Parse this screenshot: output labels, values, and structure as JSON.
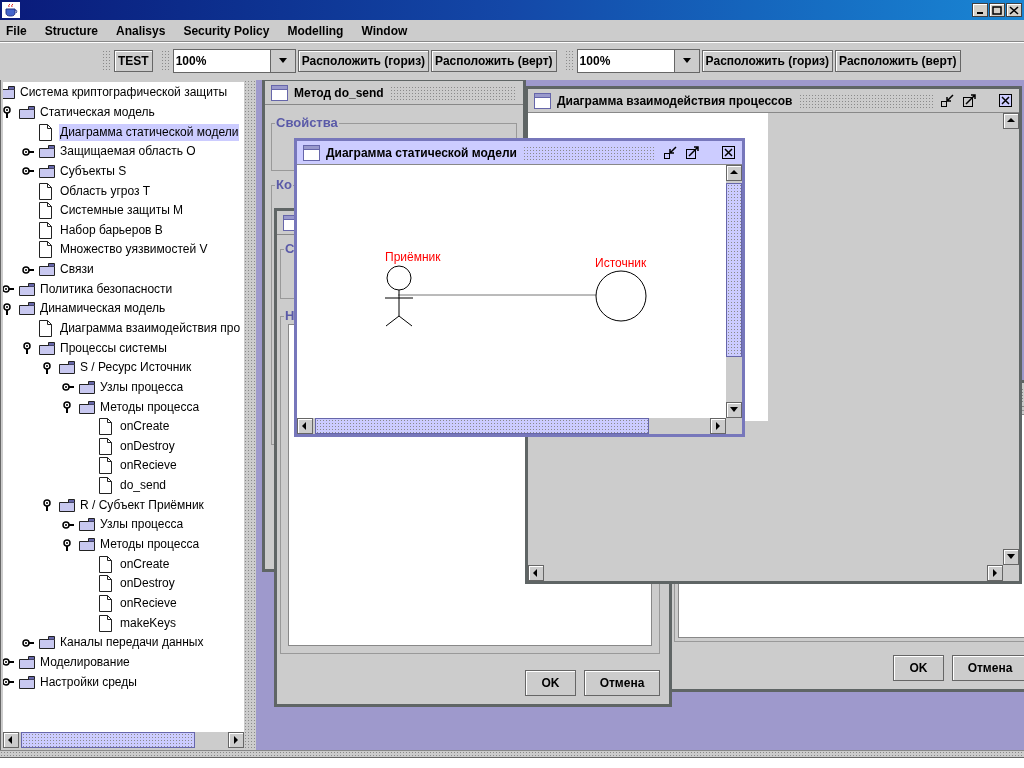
{
  "menu": [
    {
      "label": "File"
    },
    {
      "label": "Structure"
    },
    {
      "label": "Analisys"
    },
    {
      "label": "Security Policy"
    },
    {
      "label": "Modelling"
    },
    {
      "label": "Window"
    }
  ],
  "toolbar": [
    {
      "items": [
        {
          "kind": "button",
          "label": "TEST"
        }
      ]
    },
    {
      "items": [
        {
          "kind": "combo",
          "value": "100%"
        },
        {
          "kind": "button",
          "label": "Расположить (гориз)"
        },
        {
          "kind": "button",
          "label": "Расположить (верт)"
        }
      ]
    },
    {
      "items": [
        {
          "kind": "combo",
          "value": "100%"
        },
        {
          "kind": "button",
          "label": "Расположить (гориз)"
        },
        {
          "kind": "button",
          "label": "Расположить (верт)"
        }
      ]
    }
  ],
  "tree": {
    "label": "Система криптографической защиты",
    "kind": "folder",
    "selected": false,
    "children": [
      {
        "label": "Статическая модель",
        "kind": "folder",
        "expanded": true,
        "selected": false,
        "children": [
          {
            "label": "Диаграмма статической модели",
            "kind": "document",
            "selected": true
          },
          {
            "label": "Защищаемая область O",
            "kind": "folder",
            "expanded": false,
            "selected": false
          },
          {
            "label": "Субъекты S",
            "kind": "folder",
            "expanded": false,
            "selected": false
          },
          {
            "label": "Область угроз T",
            "kind": "document",
            "selected": false
          },
          {
            "label": "Системные защиты M",
            "kind": "document",
            "selected": false
          },
          {
            "label": "Набор барьеров B",
            "kind": "document",
            "selected": false
          },
          {
            "label": "Множество уязвимостей V",
            "kind": "document",
            "selected": false
          },
          {
            "label": "Связи",
            "kind": "folder",
            "expanded": false,
            "selected": false
          }
        ]
      },
      {
        "label": "Политика безопасности",
        "kind": "folder",
        "expanded": false,
        "selected": false
      },
      {
        "label": "Динамическая модель",
        "kind": "folder",
        "expanded": true,
        "selected": false,
        "children": [
          {
            "label": "Диаграмма взаимодействия про",
            "kind": "document",
            "selected": false
          },
          {
            "label": "Процессы системы",
            "kind": "folder",
            "expanded": true,
            "selected": false,
            "children": [
              {
                "label": "S / Ресурс Источник",
                "kind": "folder",
                "expanded": true,
                "selected": false,
                "children": [
                  {
                    "label": "Узлы процесса",
                    "kind": "folder",
                    "expanded": false,
                    "selected": false
                  },
                  {
                    "label": "Методы процесса",
                    "kind": "folder",
                    "expanded": true,
                    "selected": false,
                    "children": [
                      {
                        "label": "onCreate",
                        "kind": "document",
                        "selected": false
                      },
                      {
                        "label": "onDestroy",
                        "kind": "document",
                        "selected": false
                      },
                      {
                        "label": "onRecieve",
                        "kind": "document",
                        "selected": false
                      },
                      {
                        "label": "do_send",
                        "kind": "document",
                        "selected": false
                      }
                    ]
                  }
                ]
              },
              {
                "label": "R / Субъект Приёмник",
                "kind": "folder",
                "expanded": true,
                "selected": false,
                "children": [
                  {
                    "label": "Узлы процесса",
                    "kind": "folder",
                    "expanded": false,
                    "selected": false
                  },
                  {
                    "label": "Методы процесса",
                    "kind": "folder",
                    "expanded": true,
                    "selected": false,
                    "children": [
                      {
                        "label": "onCreate",
                        "kind": "document",
                        "selected": false
                      },
                      {
                        "label": "onDestroy",
                        "kind": "document",
                        "selected": false
                      },
                      {
                        "label": "onRecieve",
                        "kind": "document",
                        "selected": false
                      },
                      {
                        "label": "makeKeys",
                        "kind": "document",
                        "selected": false
                      }
                    ]
                  }
                ]
              }
            ]
          },
          {
            "label": "Каналы передачи данных",
            "kind": "folder",
            "expanded": false,
            "selected": false
          }
        ]
      },
      {
        "label": "Моделирование",
        "kind": "folder",
        "expanded": false,
        "selected": false
      },
      {
        "label": "Настройки среды",
        "kind": "folder",
        "expanded": false,
        "selected": false
      }
    ]
  },
  "internal_windows": [
    {
      "kind": "form",
      "active": false,
      "title": "Метод do_send",
      "groups": [
        "Свойства",
        "Ко"
      ]
    },
    {
      "kind": "diagram",
      "active": false,
      "title": "Диаграмма взаимодействия процессов"
    },
    {
      "kind": "diagram",
      "active": true,
      "title": "Диаграмма статической модели",
      "elements": [
        {
          "kind": "actor",
          "label": "Приёмник"
        },
        {
          "kind": "node",
          "label": "Источник"
        }
      ]
    },
    {
      "kind": "dialog",
      "active": false,
      "groups": [
        "С",
        "Н"
      ],
      "buttons": [
        "OK",
        "Отмена"
      ]
    },
    {
      "kind": "dialog",
      "active": false,
      "buttons": [
        "OK",
        "Отмена"
      ]
    }
  ]
}
